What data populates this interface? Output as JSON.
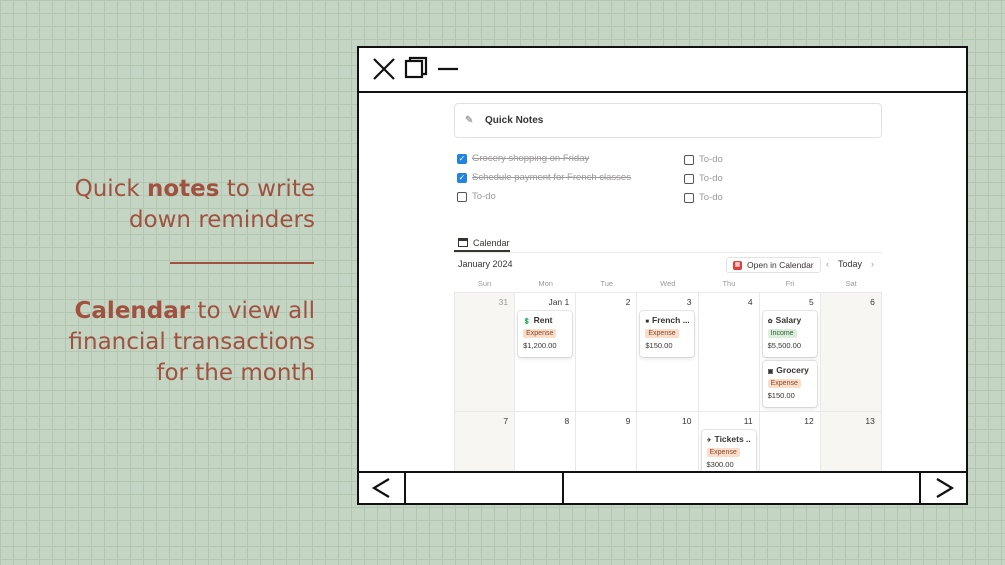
{
  "slide": {
    "line1_pre": "Quick ",
    "line1_bold": "notes",
    "line1_post": " to write",
    "line2": "down reminders",
    "line3_bold": "Calendar",
    "line3_post": " to view all",
    "line4": "financial transactions",
    "line5": "for the month"
  },
  "colors": {
    "accent": "#a0513f",
    "background": "#c5d5c4"
  },
  "quick_notes": {
    "title": "Quick Notes",
    "left_todos": [
      {
        "label": "Grocery shopping on Friday",
        "checked": true
      },
      {
        "label": "Schedule payment for French classes",
        "checked": true
      },
      {
        "label": "To-do",
        "checked": false
      }
    ],
    "right_todos": [
      {
        "label": "To-do",
        "checked": false
      },
      {
        "label": "To-do",
        "checked": false
      },
      {
        "label": "To-do",
        "checked": false
      }
    ]
  },
  "calendar": {
    "tab_label": "Calendar",
    "month": "January 2024",
    "open_button": "Open in Calendar",
    "today_label": "Today",
    "weekdays": [
      "Sun",
      "Mon",
      "Tue",
      "Wed",
      "Thu",
      "Fri",
      "Sat"
    ],
    "days": [
      "31",
      "Jan 1",
      "2",
      "3",
      "4",
      "5",
      "6",
      "7",
      "8",
      "9",
      "10",
      "11",
      "12",
      "13"
    ],
    "events": {
      "rent": {
        "title": "Rent",
        "tag": "Expense",
        "amount": "$1,200.00"
      },
      "french": {
        "title": "French ...",
        "tag": "Expense",
        "amount": "$150.00"
      },
      "salary": {
        "title": "Salary",
        "tag": "Income",
        "amount": "$5,500.00"
      },
      "grocery": {
        "title": "Grocery",
        "tag": "Expense",
        "amount": "$150.00"
      },
      "tickets": {
        "title": "Tickets ...",
        "tag": "Expense",
        "amount": "$300.00"
      }
    }
  }
}
